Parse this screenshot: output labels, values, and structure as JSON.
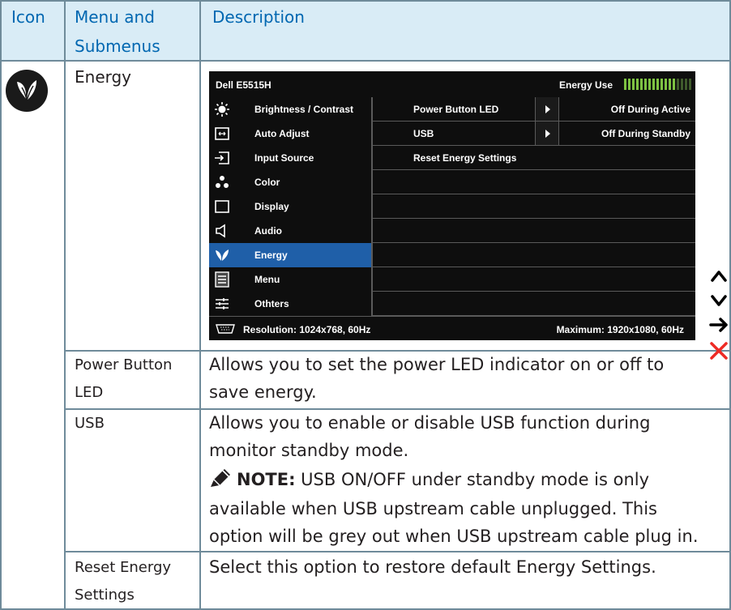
{
  "header": {
    "col_icon": "Icon",
    "col_menu_line1": "Menu and",
    "col_menu_line2": "Submenus",
    "col_desc": "Description"
  },
  "energy_row": {
    "icon": "energy-leaf-icon",
    "label": "Energy"
  },
  "osd": {
    "model": "Dell E5515H",
    "energy_use_label": "Energy Use",
    "energy_meter": {
      "lit": 13,
      "total": 17
    },
    "menu_items": [
      {
        "label": "Brightness / Contrast",
        "icon": "brightness-icon"
      },
      {
        "label": "Auto Adjust",
        "icon": "auto-adjust-icon"
      },
      {
        "label": "Input Source",
        "icon": "input-source-icon"
      },
      {
        "label": "Color",
        "icon": "color-icon"
      },
      {
        "label": "Display",
        "icon": "display-icon"
      },
      {
        "label": "Audio",
        "icon": "audio-icon"
      },
      {
        "label": "Energy",
        "icon": "energy-icon",
        "selected": true
      },
      {
        "label": "Menu",
        "icon": "menu-icon"
      },
      {
        "label": "Othters",
        "icon": "others-icon"
      }
    ],
    "submenu": [
      {
        "label": "Power Button LED",
        "value": "Off During Active"
      },
      {
        "label": "USB",
        "value": "Off During Standby"
      },
      {
        "label": "Reset Energy Settings",
        "value": ""
      }
    ],
    "resolution": "Resolution: 1024x768, 60Hz",
    "maximum": "Maximum: 1920x1080, 60Hz",
    "accent_color": "#1f5fa8",
    "meter_color": "#7dc242"
  },
  "nav_keys": [
    "up-arrow-icon",
    "down-arrow-icon",
    "right-arrow-icon",
    "close-icon"
  ],
  "rows": [
    {
      "name": "Power Button",
      "name2": "LED",
      "desc_line1": "Allows you to set the power LED indicator on or off to",
      "desc_line2": "save energy."
    },
    {
      "name": "USB",
      "desc_line1": "Allows you to enable or disable USB function during",
      "desc_line2": "monitor standby mode.",
      "note_label": "NOTE:",
      "note_line1": " USB ON/OFF under standby mode is only",
      "note_line2": "available when USB upstream cable unplugged. This",
      "note_line3": "option will be grey out when USB upstream cable plug in."
    },
    {
      "name": "Reset Energy",
      "name2": "Settings",
      "desc_line1": "Select this option to restore default Energy Settings."
    }
  ]
}
